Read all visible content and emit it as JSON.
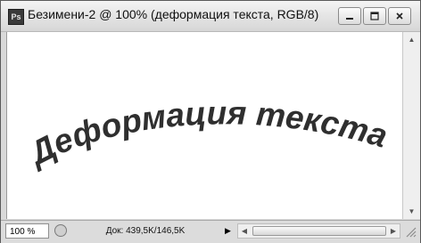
{
  "window": {
    "app_icon_text": "Ps",
    "title": "Безимени-2 @ 100% (деформация текста, RGB/8)"
  },
  "canvas": {
    "warped_text": "Деформация текста"
  },
  "status": {
    "zoom": "100 %",
    "doc_info": "Док: 439,5K/146,5K"
  },
  "icons": {
    "minimize": "minimize-icon",
    "maximize": "maximize-icon",
    "close": "close-icon"
  }
}
